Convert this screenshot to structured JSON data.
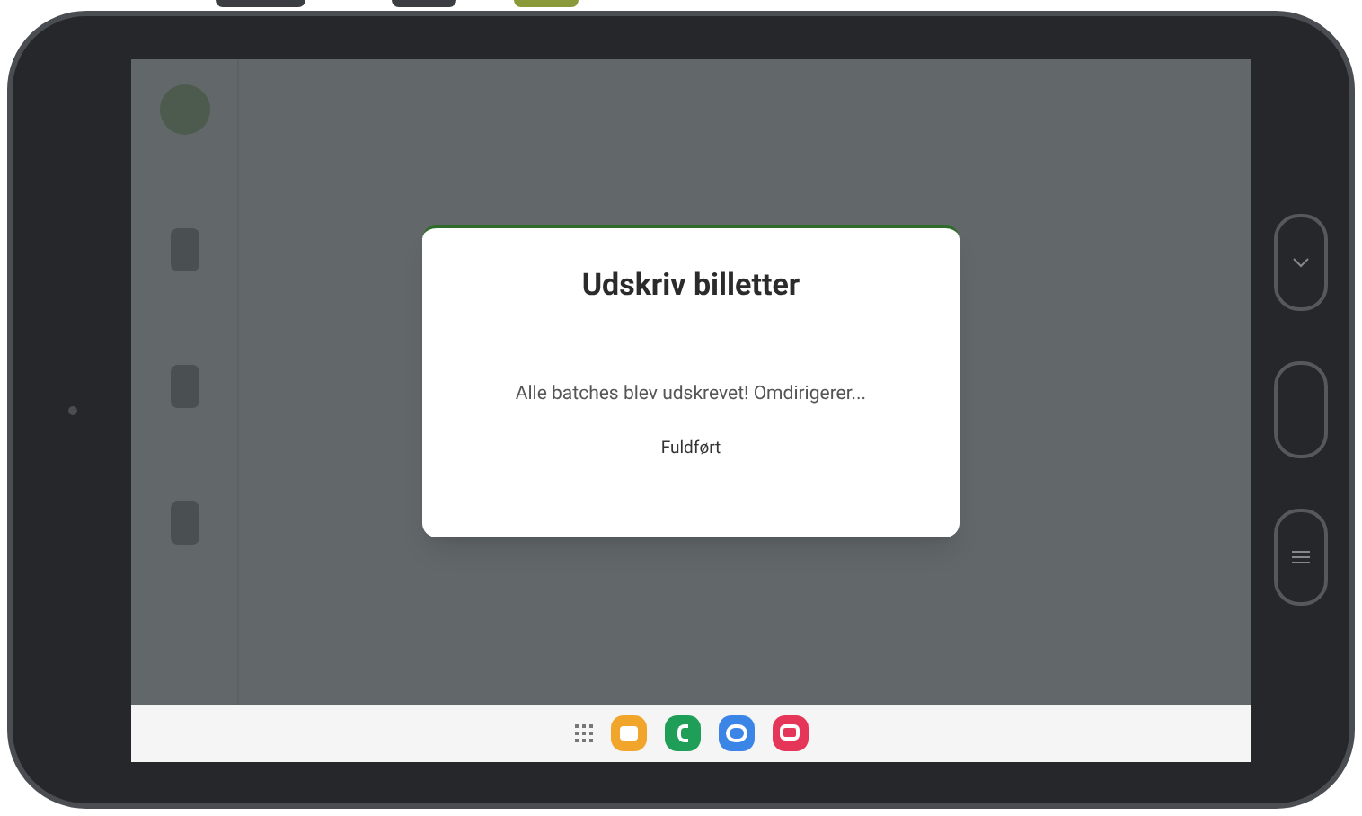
{
  "dialog": {
    "title": "Udskriv billetter",
    "message": "Alle batches blev udskrevet! Omdirigerer...",
    "status": "Fuldført"
  }
}
